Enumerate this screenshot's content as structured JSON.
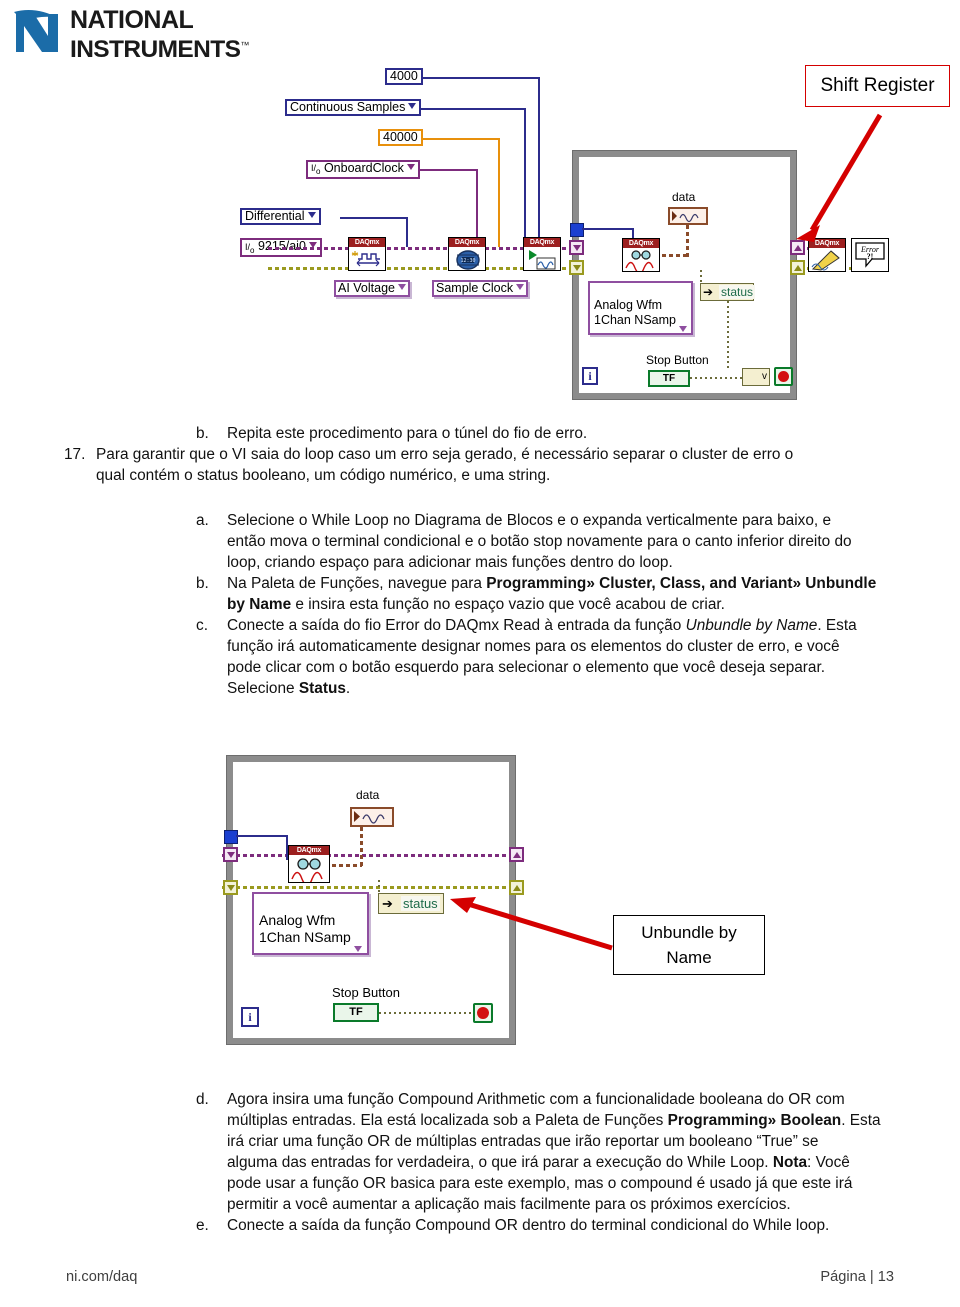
{
  "logo": {
    "line1": "NATIONAL",
    "line2": "INSTRUMENTS",
    "tm": "™"
  },
  "top_diagram": {
    "constants": {
      "samples_per_channel": "4000",
      "sample_mode": "Continuous Samples",
      "rate": "40000",
      "clock_source": "OnboardClock",
      "terminal_config": "Differential",
      "physical_channel": "9215/ai0"
    },
    "vi_labels": {
      "create_channel": "AI Voltage",
      "timing": "Sample Clock",
      "read": "Analog Wfm\n1Chan NSamp"
    },
    "vi_captions": {
      "daqmx": "DAQmx"
    },
    "indicators": {
      "data": "data",
      "status": "status",
      "stop_button": "Stop Button",
      "boolean_text": "TF"
    },
    "loop_index": "i",
    "error_vi": "Error\n?!",
    "callout": "Shift Register"
  },
  "bottom_diagram": {
    "indicators": {
      "data": "data",
      "status": "status",
      "stop_button": "Stop Button",
      "boolean_text": "TF"
    },
    "vi_labels": {
      "read": "Analog Wfm\n1Chan NSamp"
    },
    "vi_captions": {
      "daqmx": "DAQmx"
    },
    "loop_index": "i",
    "callout_line1": "Unbundle by",
    "callout_line2": "Name"
  },
  "content": {
    "item_b_marker": "b.",
    "item_b": "Repita este procedimento para o túnel do fio de erro.",
    "item_17_marker": "17.",
    "item_17_l1": "Para garantir que o VI saia do loop caso um erro seja gerado, é necessário separar o cluster de erro o",
    "item_17_l2": "qual contém o status booleano, um código numérico, e uma string.",
    "item_a_marker": "a.",
    "item_a_l1": "Selecione o While Loop no Diagrama de Blocos e o expanda verticalmente para baixo, e",
    "item_a_l2": "então mova o terminal condicional e o botão stop novamente para o canto inferior direito do",
    "item_a_l3": "loop, criando espaço para adicionar mais funções dentro do loop.",
    "item_c_marker": "b.",
    "item_c_l1_a": "Na Paleta de Funções, navegue para ",
    "item_c_l1_b": "Programming» Cluster, Class, and Variant» Unbundle",
    "item_c_l2_a": "by Name",
    "item_c_l2_b": " e insira esta função no espaço vazio que você acabou de criar.",
    "item_d_marker": "c.",
    "item_d_l1_a": "Conecte a saída do fio Error do DAQmx Read à entrada da função ",
    "item_d_l1_b": "Unbundle by Name",
    "item_d_l1_c": ". Esta",
    "item_d_l2": "função irá automaticamente designar nomes para os elementos do cluster de erro, e você",
    "item_d_l3": "pode clicar com o botão esquerdo para selecionar o elemento que você deseja separar.",
    "item_d_l4_a": "Selecione ",
    "item_d_l4_b": "Status",
    "item_d_l4_c": ".",
    "item_e_marker": "d.",
    "item_e_l1": "Agora insira uma função Compound Arithmetic com a funcionalidade booleana do OR com",
    "item_e_l2_a": "múltiplas entradas. Ela está localizada sob a Paleta de Funções ",
    "item_e_l2_b": "Programming» Boolean",
    "item_e_l2_c": ".  Esta",
    "item_e_l3": "irá criar uma função OR de múltiplas entradas que irão reportar um booleano “True” se",
    "item_e_l4_a": "alguma das entradas for verdadeira, o que irá parar a execução do While Loop.  ",
    "item_e_l4_b": "Nota",
    "item_e_l4_c": ": Você",
    "item_e_l5": "pode usar a função OR basica para este exemplo, mas o compound é usado já que este irá",
    "item_e_l6": "permitir a você aumentar a aplicação mais facilmente para os próximos exercícios.",
    "item_f_marker": "e.",
    "item_f_l1": "Conecte a saída da função Compound OR dentro do terminal condicional do While loop."
  },
  "footer": {
    "left": "ni.com/daq",
    "right": "Página | 13"
  }
}
